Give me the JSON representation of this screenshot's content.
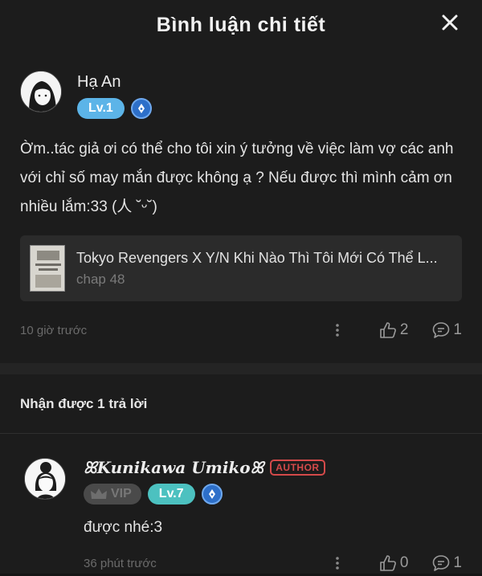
{
  "header": {
    "title": "Bình luận chi tiết"
  },
  "comment": {
    "username": "Hạ An",
    "level": "Lv.1",
    "text": "Ờm..tác giả ơi có thể cho tôi xin ý tưởng về việc làm vợ các anh với chỉ số may mắn được không ạ ? Nếu được thì mình cảm ơn nhiều lắm:33 (人 ˘ᵕ˘)",
    "chapter_card": {
      "title": "Tokyo Revengers X Y/N Khi Nào Thì Tôi Mới Có Thể L...",
      "chapter": "chap 48"
    },
    "time": "10 giờ trước",
    "likes": "2",
    "replies": "1"
  },
  "replies_header": "Nhận được 1 trả lời",
  "reply": {
    "username": "ꕤKunikawa Umikoꕤ",
    "author_tag": "AUTHOR",
    "vip_label": "VIP",
    "level": "Lv.7",
    "text": "được nhé:3",
    "time": "36 phút trước",
    "likes": "0",
    "replies": "1"
  },
  "colors": {
    "background": "#1c1c1c",
    "level1_badge": "#5cb4e8",
    "level7_badge": "#4cc1c0",
    "author_tag": "#d34a4a"
  }
}
